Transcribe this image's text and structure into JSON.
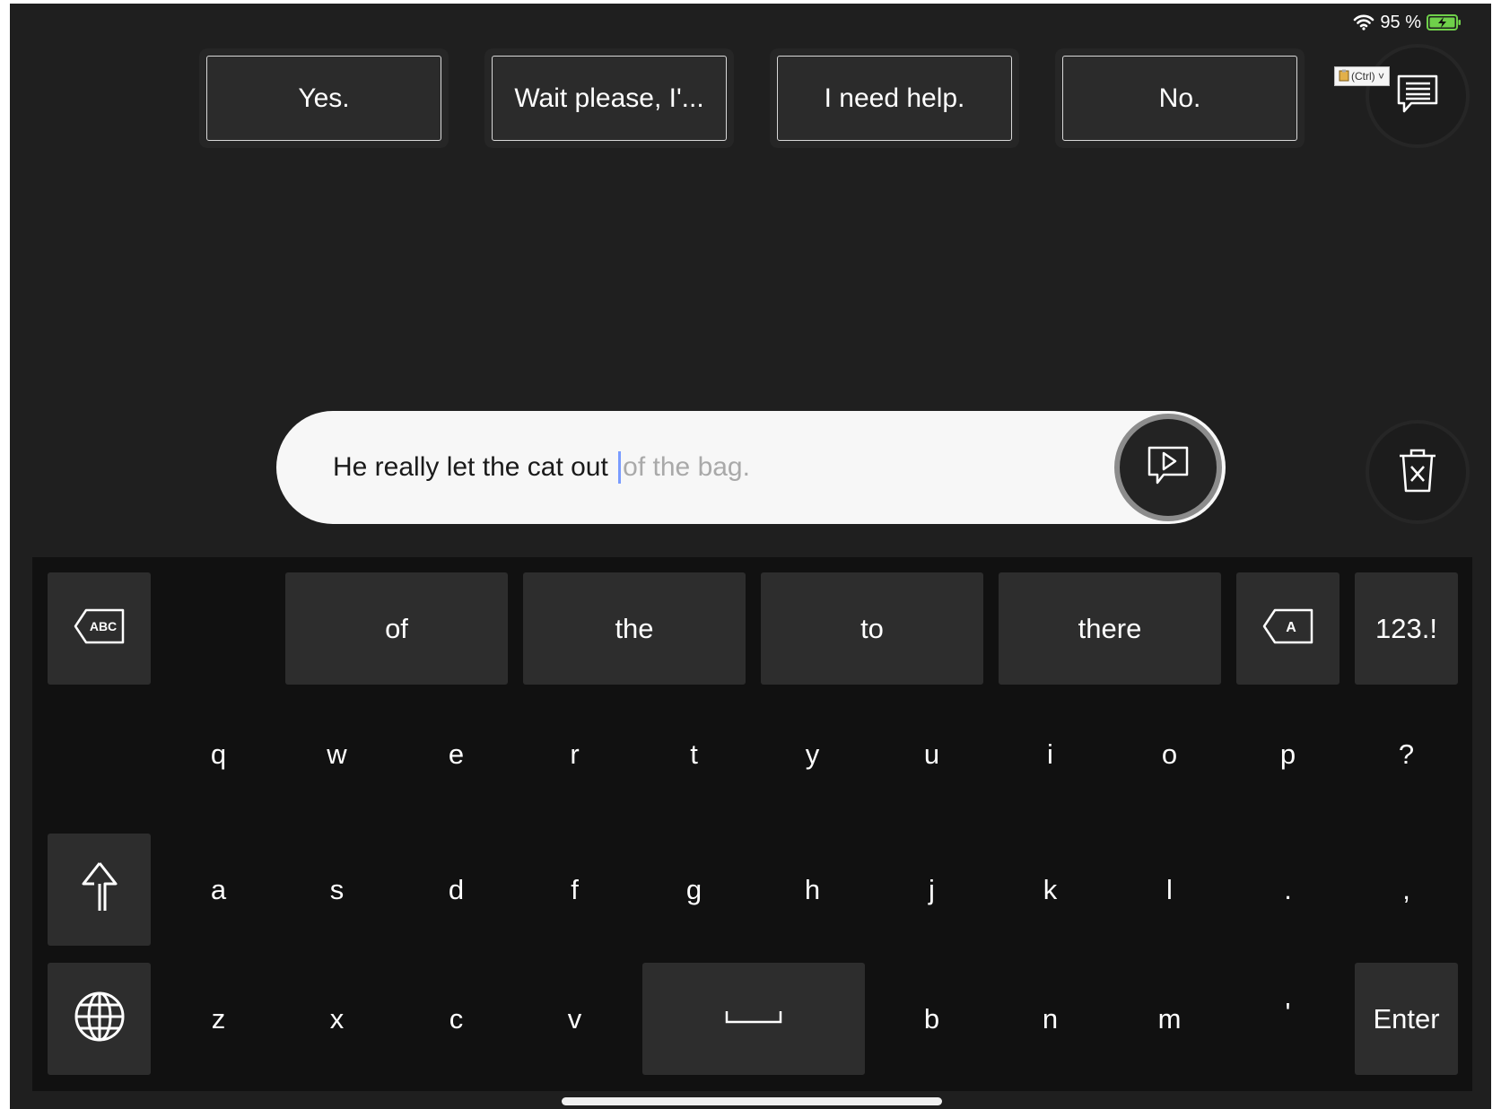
{
  "status_bar": {
    "battery_percent": "95 %",
    "wifi_icon": "wifi-icon",
    "battery_icon": "battery-charging-icon"
  },
  "phrases": [
    "Yes.",
    "Wait please, I'...",
    "I need help.",
    "No."
  ],
  "paste_tooltip": "(Ctrl) ˅",
  "phrase_list_icon": "speech-list-icon",
  "text_field": {
    "typed_text": "He really let the cat out ",
    "suggestion": "of the bag."
  },
  "speak_icon": "speak-play-icon",
  "clear_icon": "trash-clear-icon",
  "keyboard": {
    "abc_backspace_icon": "abc-backspace-icon",
    "word_suggestions": [
      "of",
      "the",
      "to",
      "there"
    ],
    "letter_backspace_icon": "letter-backspace-icon",
    "numbers_label": "123.!",
    "row1": [
      "q",
      "w",
      "e",
      "r",
      "t",
      "y",
      "u",
      "i",
      "o",
      "p",
      "?"
    ],
    "row2": [
      "a",
      "s",
      "d",
      "f",
      "g",
      "h",
      "j",
      "k",
      "l",
      ".",
      ","
    ],
    "row3_left": [
      "z",
      "x",
      "c",
      "v"
    ],
    "row3_right": [
      "b",
      "n",
      "m",
      "'"
    ],
    "shift_icon": "shift-arrow-icon",
    "globe_icon": "globe-icon",
    "space_icon": "space-bar-icon",
    "enter_label": "Enter"
  },
  "colors": {
    "background": "#1f1f1f",
    "keyboard": "#111111",
    "key": "#2d2d2d",
    "caret": "#7a9cff"
  }
}
